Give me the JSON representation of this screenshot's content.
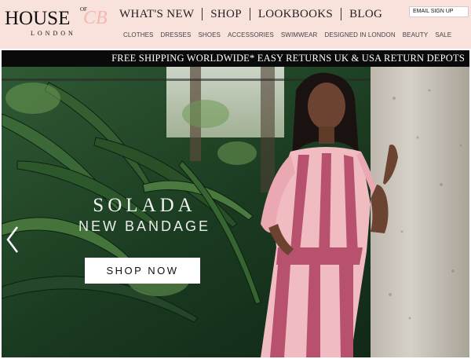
{
  "brand": {
    "main": "HOUSE",
    "of": "OF",
    "cb": "CB",
    "sub": "LONDON"
  },
  "main_nav": {
    "items": [
      "WHAT'S NEW",
      "SHOP",
      "LOOKBOOKS",
      "BLOG"
    ]
  },
  "email_signup": {
    "label": "EMAIL SIGN UP"
  },
  "sub_nav": {
    "items": [
      "CLOTHES",
      "DRESSES",
      "SHOES",
      "ACCESSORIES",
      "SWIMWEAR",
      "DESIGNED IN LONDON",
      "BEAUTY",
      "SALE"
    ]
  },
  "banner": {
    "text": "FREE SHIPPING WORLDWIDE* EASY RETURNS UK & USA RETURN DEPOTS"
  },
  "hero": {
    "title": "SOLADA",
    "subtitle": "NEW BANDAGE",
    "cta_label": "SHOP NOW",
    "prev_icon": "chevron-left-icon"
  },
  "colors": {
    "header_bg": "#f9e2dc",
    "banner_bg": "#0a0a0a",
    "logo_accent": "#f3b8b2",
    "dress_rose": "#b7516e",
    "dress_blush": "#f0bcc2"
  }
}
